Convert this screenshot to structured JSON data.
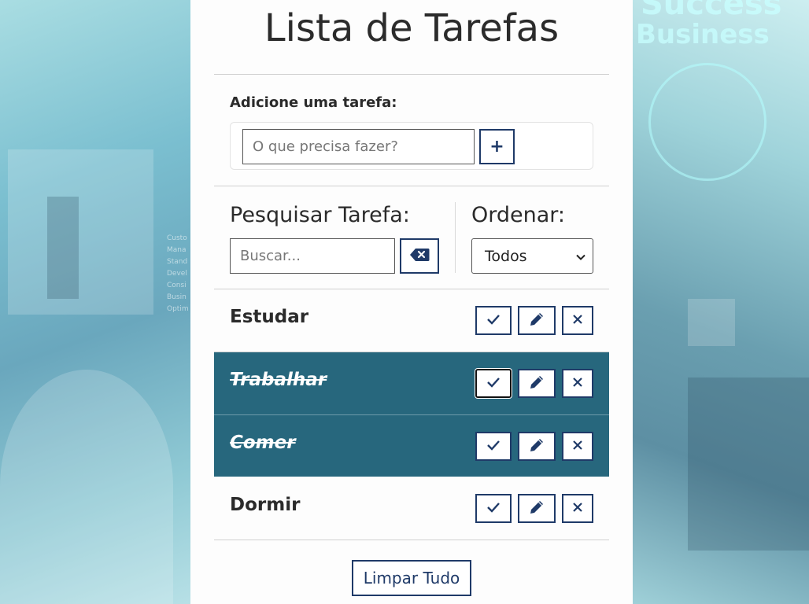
{
  "app": {
    "title": "Lista de Tarefas"
  },
  "add": {
    "label": "Adicione uma tarefa:",
    "placeholder": "O que precisa fazer?",
    "button": "+"
  },
  "search": {
    "label": "Pesquisar Tarefa:",
    "placeholder": "Buscar..."
  },
  "order": {
    "label": "Ordenar:",
    "selected": "Todos"
  },
  "tasks": [
    {
      "name": "Estudar",
      "done": false
    },
    {
      "name": "Trabalhar",
      "done": true
    },
    {
      "name": "Comer",
      "done": true
    },
    {
      "name": "Dormir",
      "done": false
    }
  ],
  "footer": {
    "clear_all": "Limpar Tudo"
  },
  "background": {
    "headline_1": "Success",
    "headline_2": "Business"
  },
  "colors": {
    "accent": "#1f3a68",
    "done_row": "#27677d"
  },
  "icons": [
    "check-icon",
    "pencil-icon",
    "x-icon",
    "backspace-icon",
    "plus-icon",
    "chevron-down-icon"
  ]
}
